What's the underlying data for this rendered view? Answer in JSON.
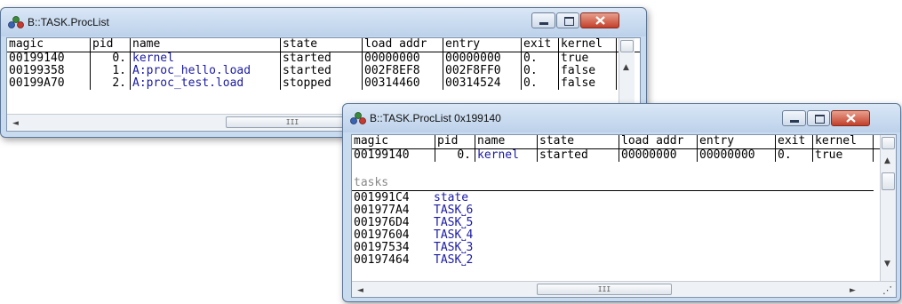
{
  "window1": {
    "title": "B::TASK.ProcList",
    "columns": [
      "magic",
      "pid",
      "name",
      "state",
      "load addr",
      "entry",
      "exit",
      "kernel"
    ],
    "rows": [
      {
        "magic": "00199140",
        "pid": "0.",
        "name": "kernel",
        "state": "started",
        "load_addr": "00000000",
        "entry": "00000000",
        "exit": "0.",
        "kernel": "true"
      },
      {
        "magic": "00199358",
        "pid": "1.",
        "name": "A:proc_hello.load",
        "state": "started",
        "load_addr": "002F8EF8",
        "entry": "002F8FF0",
        "exit": "0.",
        "kernel": "false"
      },
      {
        "magic": "00199A70",
        "pid": "2.",
        "name": "A:proc_test.load",
        "state": "stopped",
        "load_addr": "00314460",
        "entry": "00314524",
        "exit": "0.",
        "kernel": "false"
      }
    ],
    "scroll_thumb_label": "III",
    "left_arrow": "◄"
  },
  "window2": {
    "title": "B::TASK.ProcList 0x199140",
    "columns": [
      "magic",
      "pid",
      "name",
      "state",
      "load addr",
      "entry",
      "exit",
      "kernel"
    ],
    "row": {
      "magic": "00199140",
      "pid": "0.",
      "name": "kernel",
      "state": "started",
      "load_addr": "00000000",
      "entry": "00000000",
      "exit": "0.",
      "kernel": "true"
    },
    "section_label": "tasks",
    "tasks": [
      {
        "addr": "001991C4",
        "label": "state"
      },
      {
        "addr": "001977A4",
        "label": "TASK˽6"
      },
      {
        "addr": "001976D4",
        "label": "TASK˽5"
      },
      {
        "addr": "00197604",
        "label": "TASK˽4"
      },
      {
        "addr": "00197534",
        "label": "TASK˽3"
      },
      {
        "addr": "00197464",
        "label": "TASK˽2"
      }
    ],
    "scroll_thumb_label": "III",
    "left_arrow": "◄",
    "right_arrow": "►",
    "up_arrow": "▲",
    "down_arrow": "▼"
  },
  "icons": [
    "app-icon",
    "minimize-icon",
    "maximize-icon",
    "close-icon",
    "scroll-left-icon",
    "scroll-right-icon",
    "scroll-up-icon",
    "scroll-down-icon",
    "resize-grip-icon"
  ]
}
